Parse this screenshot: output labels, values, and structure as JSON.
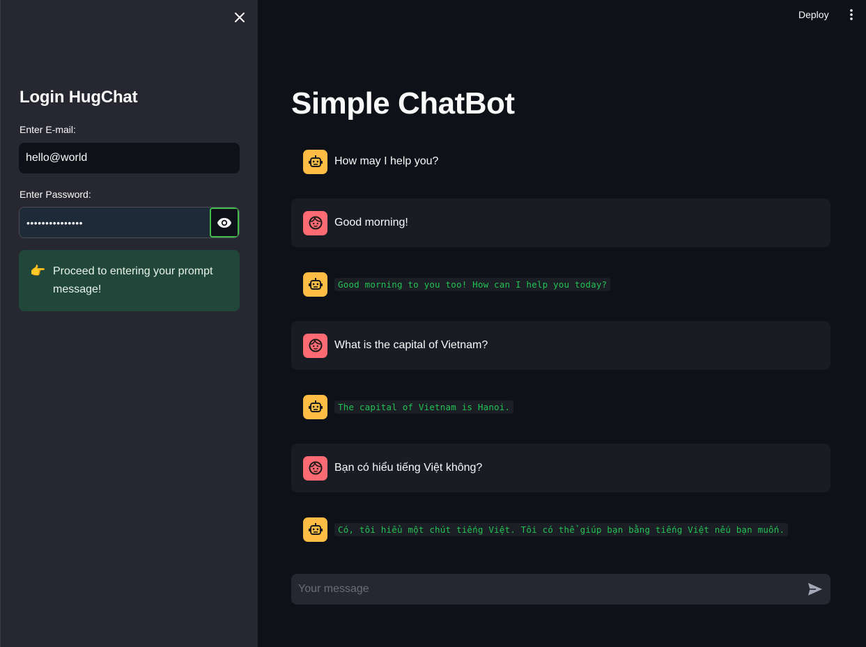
{
  "sidebar": {
    "title": "Login HugChat",
    "email_label": "Enter E-mail:",
    "email_value": "hello@world",
    "password_label": "Enter Password:",
    "password_value": "•••••••••••••••",
    "success_icon": "👉",
    "success_message": "Proceed to entering your prompt message!"
  },
  "header": {
    "deploy_label": "Deploy"
  },
  "main": {
    "title": "Simple ChatBot",
    "messages": [
      {
        "role": "assistant",
        "text": "How may I help you?",
        "style": "plain"
      },
      {
        "role": "user",
        "text": "Good morning!",
        "style": "plain"
      },
      {
        "role": "assistant",
        "text": "Good morning to you too! How can I help you today?",
        "style": "code"
      },
      {
        "role": "user",
        "text": "What is the capital of Vietnam?",
        "style": "plain"
      },
      {
        "role": "assistant",
        "text": "The capital of Vietnam is Hanoi.",
        "style": "code"
      },
      {
        "role": "user",
        "text": "Bạn có hiểu tiếng Việt không?",
        "style": "plain"
      },
      {
        "role": "assistant",
        "text": "Có, tôi hiểu một chút tiếng Việt. Tôi có thể giúp bạn bằng tiếng Việt nếu bạn muốn.",
        "style": "code"
      }
    ],
    "input_placeholder": "Your message"
  },
  "colors": {
    "assistant_avatar": "#ffbd45",
    "user_avatar": "#ff6b72",
    "success_bg": "#21473a",
    "code_text": "#21c354"
  },
  "icons": {
    "assistant_avatar": "robot-icon",
    "user_avatar": "face-icon",
    "close": "close-icon",
    "password_toggle": "eye-icon",
    "menu": "kebab-menu-icon",
    "send": "send-icon"
  }
}
